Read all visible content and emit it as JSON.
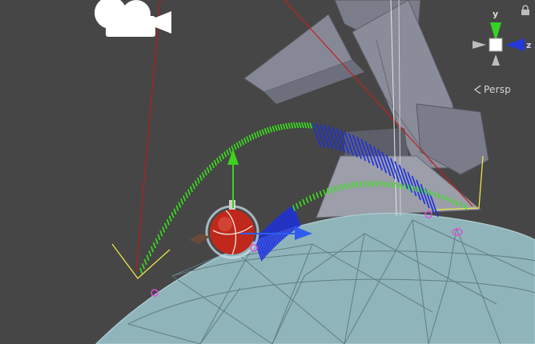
{
  "scene_view": {
    "projection_label": "Persp",
    "gizmo": {
      "axis_y": "y",
      "axis_z": "z"
    },
    "colors": {
      "background": "#464646",
      "ground": "#8fb4ba",
      "ground_lines": "#5f7e84",
      "structure": "#8a8c99",
      "arc_green": "#37e51a",
      "arc_blue": "#1b2fe0",
      "ball": "#c0281b",
      "red_ray": "#b81c1c",
      "yellow_line": "#e8e44c",
      "marker": "#e04fd8"
    },
    "icons": [
      "camera-icon",
      "lock-icon",
      "orientation-gizmo",
      "move-tool-gizmo",
      "ball-object"
    ]
  }
}
